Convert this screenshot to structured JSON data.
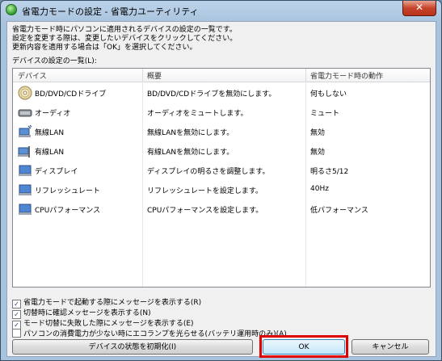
{
  "window": {
    "title": "省電力モードの設定 - 省電力ユーティリティ",
    "close_glyph": "✕"
  },
  "description": [
    "省電力モード時にパソコンに適用されるデバイスの設定の一覧です。",
    "設定を変更する際は、変更したいデバイスをクリックしてください。",
    "更新内容を適用する場合は「OK」を選択してください。"
  ],
  "list_label": "デバイスの設定の一覧(L):",
  "columns": [
    "デバイス",
    "概要",
    "省電力モード時の動作"
  ],
  "rows": [
    {
      "icon": "cd-drive-icon",
      "device": "BD/DVD/CDドライブ",
      "summary": "BD/DVD/CDドライブを無効にします。",
      "action": "何もしない"
    },
    {
      "icon": "audio-icon",
      "device": "オーディオ",
      "summary": "オーディオをミュートします。",
      "action": "ミュート"
    },
    {
      "icon": "wireless-lan-icon",
      "device": "無線LAN",
      "summary": "無線LANを無効にします。",
      "action": "無効"
    },
    {
      "icon": "wired-lan-icon",
      "device": "有線LAN",
      "summary": "有線LANを無効にします。",
      "action": "無効"
    },
    {
      "icon": "display-icon",
      "device": "ディスプレイ",
      "summary": "ディスプレイの明るさを調整します。",
      "action": "明るさ5/12"
    },
    {
      "icon": "refresh-rate-icon",
      "device": "リフレッシュレート",
      "summary": "リフレッシュレートを設定します。",
      "action": "40Hz"
    },
    {
      "icon": "cpu-icon",
      "device": "CPUパフォーマンス",
      "summary": "CPUパフォーマンスを設定します。",
      "action": "低パフォーマンス"
    }
  ],
  "checkboxes": [
    {
      "label": "省電力モードで起動する際にメッセージを表示する(R)",
      "checked": true
    },
    {
      "label": "切替時に確認メッセージを表示する(N)",
      "checked": true
    },
    {
      "label": "モード切替に失敗した際にメッセージを表示する(E)",
      "checked": true
    },
    {
      "label": "パソコンの消費電力が少ない時にエコランプを光らせる(バッテリ運用時のみ)(A)",
      "checked": false
    }
  ],
  "buttons": {
    "reset": "デバイスの状態を初期化(I)",
    "ok": "OK",
    "cancel": "キャンセル"
  },
  "colors": {
    "highlight": "#e00000",
    "titlebar": "#bcd3ea"
  }
}
